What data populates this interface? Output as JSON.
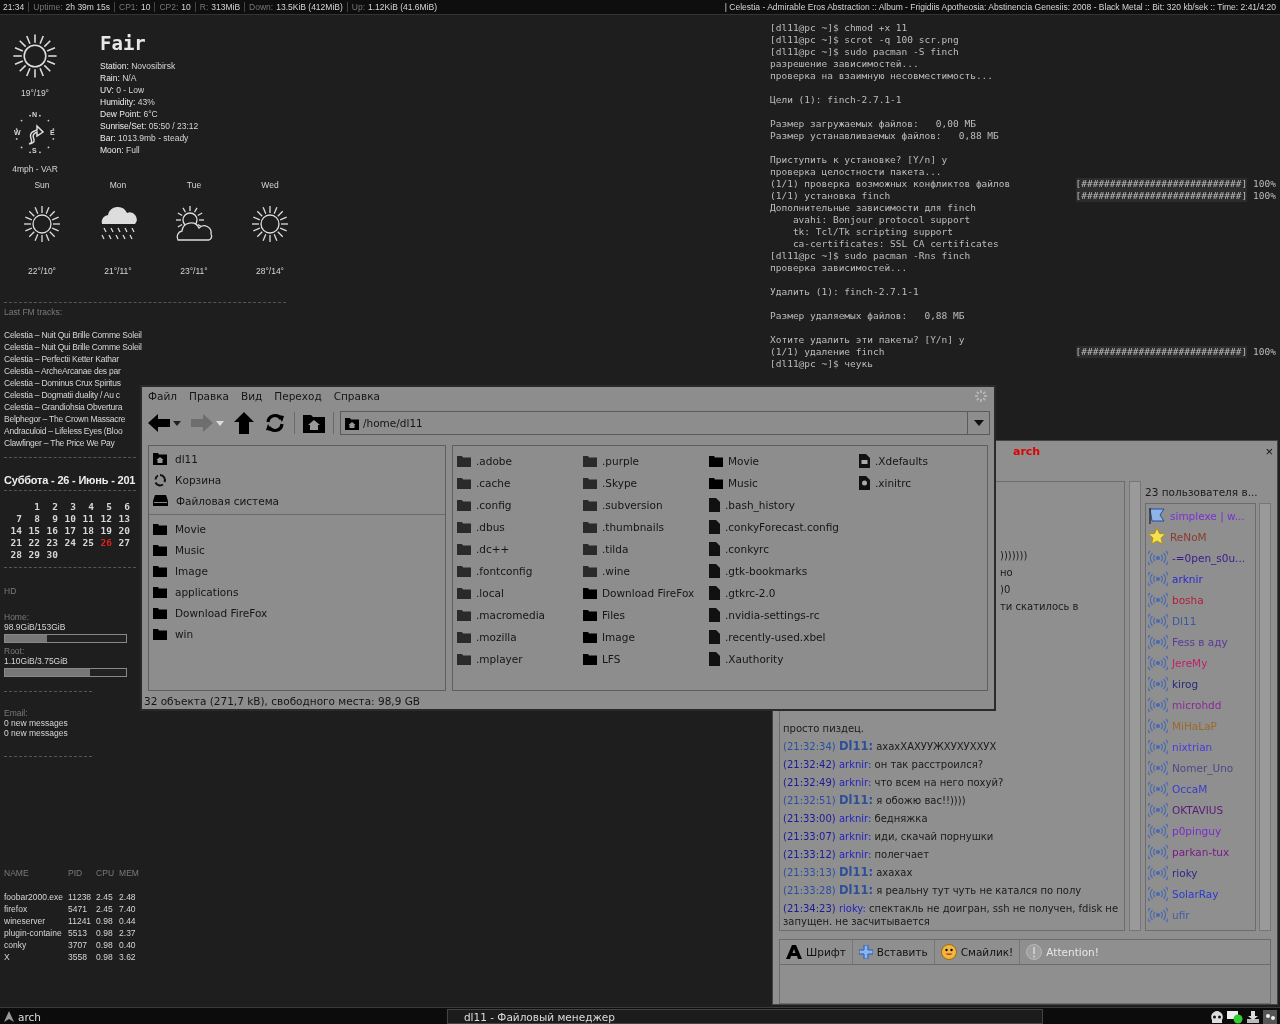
{
  "top_bar": {
    "clock": "21:34",
    "stats": [
      {
        "label": "Uptime:",
        "value": "2h 39m 15s"
      },
      {
        "label": "CP1:",
        "value": "10"
      },
      {
        "label": "CP2:",
        "value": "10"
      },
      {
        "label": "R:",
        "value": "313MiB"
      },
      {
        "label": "Down:",
        "value": "13.5KiB (412MiB)"
      },
      {
        "label": "Up:",
        "value": "1.12KiB (41.6MiB)"
      }
    ],
    "now_playing": "| Celestia -  Admirable Eros Abstraction  ::  Album - Frigidiis Apotheosia: Abstinencia Genesiis: 2008 - Black Metal  ::  Bit: 320 kb/sek  ::  Time: 2:41/4:20"
  },
  "weather": {
    "condition": "Fair",
    "temperature": "19°/19°",
    "compass": [
      "N",
      "E",
      "S",
      "W"
    ],
    "wind": "4mph - VAR",
    "details": [
      {
        "label": "Station:",
        "value": "Novosibirsk"
      },
      {
        "label": "Rain:",
        "value": "N/A"
      },
      {
        "label": "UV:",
        "value": "0 - Low"
      },
      {
        "label": "Humidity:",
        "value": "43%"
      },
      {
        "label": "Dew Point:",
        "value": "6°C"
      },
      {
        "label": "Sunrise/Set:",
        "value": "05:50 / 23:12"
      },
      {
        "label": "Bar:",
        "value": "1013.9mb - steady"
      },
      {
        "label": "Moon:",
        "value": "Full"
      }
    ],
    "forecast": [
      {
        "day": "Sun",
        "kind": "sunny",
        "temps": "22°/10°"
      },
      {
        "day": "Mon",
        "kind": "rain",
        "temps": "21°/11°"
      },
      {
        "day": "Tue",
        "kind": "partly-cloudy",
        "temps": "23°/11°"
      },
      {
        "day": "Wed",
        "kind": "sunny",
        "temps": "28°/14°"
      }
    ]
  },
  "lastfm": {
    "title": "Last FM tracks:",
    "tracks": [
      "Celestia – Nuit Qui Brille Comme Soleil",
      "Celestia – Nuit Qui Brille Comme Soleil",
      "Celestia – Perfectii Ketter Kathar",
      "Celestia – ArcheArcanae des par",
      "Celestia – Dominus Crux Spiritus",
      "Celestia – Dogmatii duality / Au c",
      "Celestia – Grandiohsia Obvertura",
      "Belphegor – The Crown Massacre",
      "Andraculoid – Lifeless Eyes (Bloo",
      "Clawfinger – The Price We Pay"
    ]
  },
  "calendar": {
    "title": "Суббота - 26 - Июнь - 201",
    "weeks": [
      {
        "kind": "leading",
        "days": [
          {
            "day": "1",
            "today": false
          },
          {
            "day": "2",
            "today": false
          },
          {
            "day": "3",
            "today": false
          },
          {
            "day": "4",
            "today": false
          },
          {
            "day": "5",
            "today": false
          },
          {
            "day": "6",
            "today": false
          }
        ]
      },
      {
        "kind": "full",
        "days": [
          {
            "day": "7",
            "today": false
          },
          {
            "day": "8",
            "today": false
          },
          {
            "day": "9",
            "today": false
          },
          {
            "day": "10",
            "today": false
          },
          {
            "day": "11",
            "today": false
          },
          {
            "day": "12",
            "today": false
          },
          {
            "day": "13",
            "today": false
          }
        ]
      },
      {
        "kind": "full",
        "days": [
          {
            "day": "14",
            "today": false
          },
          {
            "day": "15",
            "today": false
          },
          {
            "day": "16",
            "today": false
          },
          {
            "day": "17",
            "today": false
          },
          {
            "day": "18",
            "today": false
          },
          {
            "day": "19",
            "today": false
          },
          {
            "day": "20",
            "today": false
          }
        ]
      },
      {
        "kind": "full",
        "days": [
          {
            "day": "21",
            "today": false
          },
          {
            "day": "22",
            "today": false
          },
          {
            "day": "23",
            "today": false
          },
          {
            "day": "24",
            "today": false
          },
          {
            "day": "25",
            "today": false
          },
          {
            "day": "26",
            "today": true
          },
          {
            "day": "27",
            "today": false
          }
        ]
      },
      {
        "kind": "trailing",
        "days": [
          {
            "day": "28",
            "today": false
          },
          {
            "day": "29",
            "today": false
          },
          {
            "day": "30",
            "today": false
          }
        ]
      }
    ]
  },
  "disks": {
    "title": "HD",
    "items": [
      {
        "label": "Home:",
        "usage": "98.9GiB/153GiB",
        "level": 0.35
      },
      {
        "label": "Root:",
        "usage": "1.10GiB/3.75GiB",
        "level": 0.7
      }
    ]
  },
  "email": {
    "title": "Email:",
    "lines": [
      "0 new messages",
      "0 new messages"
    ]
  },
  "processes": {
    "columns": [
      "NAME",
      "PID",
      "CPU",
      "MEM"
    ],
    "rows": [
      [
        "foobar2000.exe",
        "11238",
        "2.45",
        "2.48"
      ],
      [
        "firefox",
        "5471",
        "2.45",
        "7.40"
      ],
      [
        "wineserver",
        "11241",
        "0.98",
        "0.44"
      ],
      [
        "plugin-containe",
        "5513",
        "0.98",
        "2.37"
      ],
      [
        "conky",
        "3707",
        "0.98",
        "0.40"
      ],
      [
        "X",
        "3558",
        "0.98",
        "3.62"
      ]
    ]
  },
  "terminal": {
    "blocks": [
      [
        {
          "text": "[dl11@pc ~]$ chmod +x 11"
        },
        {
          "text": "[dl11@pc ~]$ scrot -q 100 scr.png"
        },
        {
          "text": "[dl11@pc ~]$ sudo pacman -S finch"
        },
        {
          "text": "разрешение зависимостей..."
        },
        {
          "text": "проверка на взаимную несовместимость..."
        }
      ],
      [
        {
          "text": "Цели (1): finch-2.7.1-1"
        }
      ],
      [
        {
          "text": "Размер загружаемых файлов:   0,00 МБ"
        },
        {
          "text": "Размер устанавливаемых файлов:   0,88 МБ"
        }
      ],
      [
        {
          "text": "Приступить к установке? [Y/n] y"
        },
        {
          "text": "проверка целостности пакета..."
        },
        {
          "text": "(1/1) проверка возможных конфликтов файлов",
          "bar": "[############################]",
          "percent": "100%",
          "level": 1
        },
        {
          "text": "(1/1) установка finch",
          "bar": "[############################]",
          "percent": "100%",
          "level": 1
        },
        {
          "text": "Дополнительные зависимости для finch"
        },
        {
          "text": "    avahi: Bonjour protocol support"
        },
        {
          "text": "    tk: Tcl/Tk scripting support"
        },
        {
          "text": "    ca-certificates: SSL CA certificates"
        },
        {
          "text": "[dl11@pc ~]$ sudo pacman -Rns finch"
        },
        {
          "text": "проверка зависимостей..."
        }
      ],
      [
        {
          "text": "Удалить (1): finch-2.7.1-1"
        }
      ],
      [
        {
          "text": "Размер удаляемых файлов:   0,88 МБ"
        }
      ],
      [
        {
          "text": "Хотите удалить эти пакеты? [Y/n] y"
        },
        {
          "text": "(1/1) удаление finch",
          "bar": "[############################]",
          "percent": "100%",
          "level": 1
        },
        {
          "text": "[dl11@pc ~]$ чеукь"
        }
      ]
    ]
  },
  "chat": {
    "tab": "arch",
    "close": "×",
    "user_count": "23 пользователя в...",
    "covered_fragments": [
      ")))))))",
      "но",
      ")0",
      "ти скатилось в"
    ],
    "messages": [
      {
        "kind": "continuation",
        "text": "просто пиздец."
      },
      {
        "kind": "self",
        "time": "(21:32:34)",
        "nick": "Dl11:",
        "text": "ахахХАХУУЖХУХУХХУХ"
      },
      {
        "kind": "other",
        "time": "(21:32:42)",
        "nick": "arknir:",
        "text": "он так расстроился?"
      },
      {
        "kind": "other",
        "time": "(21:32:49)",
        "nick": "arknir:",
        "text": "что всем на него похуй?"
      },
      {
        "kind": "self",
        "time": "(21:32:51)",
        "nick": "Dl11:",
        "text": "я обожю вас!!))))"
      },
      {
        "kind": "other",
        "time": "(21:33:00)",
        "nick": "arknir:",
        "text": "бедняжка"
      },
      {
        "kind": "other",
        "time": "(21:33:07)",
        "nick": "arknir:",
        "text": "иди, скачай порнушки"
      },
      {
        "kind": "other",
        "time": "(21:33:12)",
        "nick": "arknir:",
        "text": "полегчает"
      },
      {
        "kind": "self",
        "time": "(21:33:13)",
        "nick": "Dl11:",
        "text": "ахахах"
      },
      {
        "kind": "self",
        "time": "(21:33:28)",
        "nick": "Dl11:",
        "text": "я реальну тут чуть не катался по полу"
      },
      {
        "kind": "other",
        "time": "(21:34:23)",
        "nick": "rioky:",
        "text": "спектакль не доигран, ssh не получен, fdisk не запущен. не засчитывается"
      }
    ],
    "users": [
      {
        "name": "simplexe | w...",
        "kind": "flag",
        "color": "#7b2fd6"
      },
      {
        "name": "ReNoM",
        "kind": "star",
        "color": "#8b3a2a"
      },
      {
        "name": "-=0pen_s0u...",
        "kind": "voice",
        "color": "#3a1a8c"
      },
      {
        "name": "arknir",
        "kind": "voice",
        "color": "#2a2ad0"
      },
      {
        "name": "bosha",
        "kind": "voice",
        "color": "#b0203a"
      },
      {
        "name": "Dl11",
        "kind": "voice",
        "color": "#3a5aa0"
      },
      {
        "name": "Fess в аду",
        "kind": "voice",
        "color": "#5a3a9a"
      },
      {
        "name": "JereMy",
        "kind": "voice",
        "color": "#c0206a"
      },
      {
        "name": "kirog",
        "kind": "voice",
        "color": "#2a2a7a"
      },
      {
        "name": "microhdd",
        "kind": "voice",
        "color": "#8a2a9a"
      },
      {
        "name": "MiHaLaP",
        "kind": "voice",
        "color": "#9a6a2a"
      },
      {
        "name": "nixtrian",
        "kind": "voice",
        "color": "#4a3ae0"
      },
      {
        "name": "Nomer_Uno",
        "kind": "voice",
        "color": "#4a4a8a"
      },
      {
        "name": "OccaM",
        "kind": "voice",
        "color": "#3a3ad0"
      },
      {
        "name": "OKTAVIUS",
        "kind": "voice",
        "color": "#5a1a7a"
      },
      {
        "name": "p0pinguy",
        "kind": "voice",
        "color": "#7a2ad0"
      },
      {
        "name": "parkan-tux",
        "kind": "voice",
        "color": "#7a1a8a"
      },
      {
        "name": "rioky",
        "kind": "voice",
        "color": "#2a2a8a"
      },
      {
        "name": "SolarRay",
        "kind": "voice",
        "color": "#2a3ad0"
      },
      {
        "name": "ufir",
        "kind": "voice",
        "color": "#4a5aa0"
      }
    ],
    "toolbar": [
      {
        "kind": "font",
        "label": "Шрифт",
        "disabled": false
      },
      {
        "kind": "insert",
        "label": "Вставить",
        "disabled": false
      },
      {
        "kind": "smiley",
        "label": "Смайлик!",
        "disabled": false
      },
      {
        "kind": "attention",
        "label": "Attention!",
        "disabled": true
      }
    ]
  },
  "file_manager": {
    "menu": [
      "Файл",
      "Правка",
      "Вид",
      "Переход",
      "Справка"
    ],
    "toolbar": [
      {
        "kind": "back",
        "disabled": false
      },
      {
        "kind": "forward",
        "disabled": true
      },
      {
        "kind": "up",
        "disabled": false
      },
      {
        "kind": "reload",
        "disabled": false
      },
      {
        "kind": "home",
        "disabled": false
      }
    ],
    "path": "/home/dl11",
    "places": [
      {
        "kind": "home",
        "label": "dl11"
      },
      {
        "kind": "trash",
        "label": "Корзина"
      },
      {
        "kind": "drive",
        "label": "Файловая система"
      }
    ],
    "bookmarks": [
      "Movie",
      "Music",
      "Image",
      "applications",
      "Download FireFox",
      "win"
    ],
    "files": [
      {
        "kind": "hidden-folder",
        "name": ".adobe"
      },
      {
        "kind": "hidden-folder",
        "name": ".cache"
      },
      {
        "kind": "hidden-folder",
        "name": ".config"
      },
      {
        "kind": "hidden-folder",
        "name": ".dbus"
      },
      {
        "kind": "hidden-folder",
        "name": ".dc++"
      },
      {
        "kind": "hidden-folder",
        "name": ".fontconfig"
      },
      {
        "kind": "hidden-folder",
        "name": ".local"
      },
      {
        "kind": "hidden-folder",
        "name": ".macromedia"
      },
      {
        "kind": "hidden-folder",
        "name": ".mozilla"
      },
      {
        "kind": "hidden-folder",
        "name": ".mplayer"
      },
      {
        "kind": "hidden-folder",
        "name": ".purple"
      },
      {
        "kind": "hidden-folder",
        "name": ".Skype"
      },
      {
        "kind": "hidden-folder",
        "name": ".subversion"
      },
      {
        "kind": "hidden-folder",
        "name": ".thumbnails"
      },
      {
        "kind": "hidden-folder",
        "name": ".tilda"
      },
      {
        "kind": "hidden-folder",
        "name": ".wine"
      },
      {
        "kind": "folder",
        "name": "Download FireFox"
      },
      {
        "kind": "folder",
        "name": "Files"
      },
      {
        "kind": "folder",
        "name": "Image"
      },
      {
        "kind": "folder",
        "name": "LFS"
      },
      {
        "kind": "folder",
        "name": "Movie"
      },
      {
        "kind": "folder",
        "name": "Music"
      },
      {
        "kind": "file",
        "name": ".bash_history"
      },
      {
        "kind": "file",
        "name": ".conkyForecast.config"
      },
      {
        "kind": "file",
        "name": ".conkyrc"
      },
      {
        "kind": "file",
        "name": ".gtk-bookmarks"
      },
      {
        "kind": "file",
        "name": ".gtkrc-2.0"
      },
      {
        "kind": "file",
        "name": ".nvidia-settings-rc"
      },
      {
        "kind": "file",
        "name": ".recently-used.xbel"
      },
      {
        "kind": "file",
        "name": ".Xauthority"
      },
      {
        "kind": "config",
        "name": ".Xdefaults"
      },
      {
        "kind": "script",
        "name": ".xinitrc"
      }
    ],
    "status": "32 объекта (271,7 kB), свободного места: 98,9 GB"
  },
  "taskbar": {
    "start": "arch",
    "tasks": [
      "dl11 - Файловый менеджер"
    ]
  }
}
